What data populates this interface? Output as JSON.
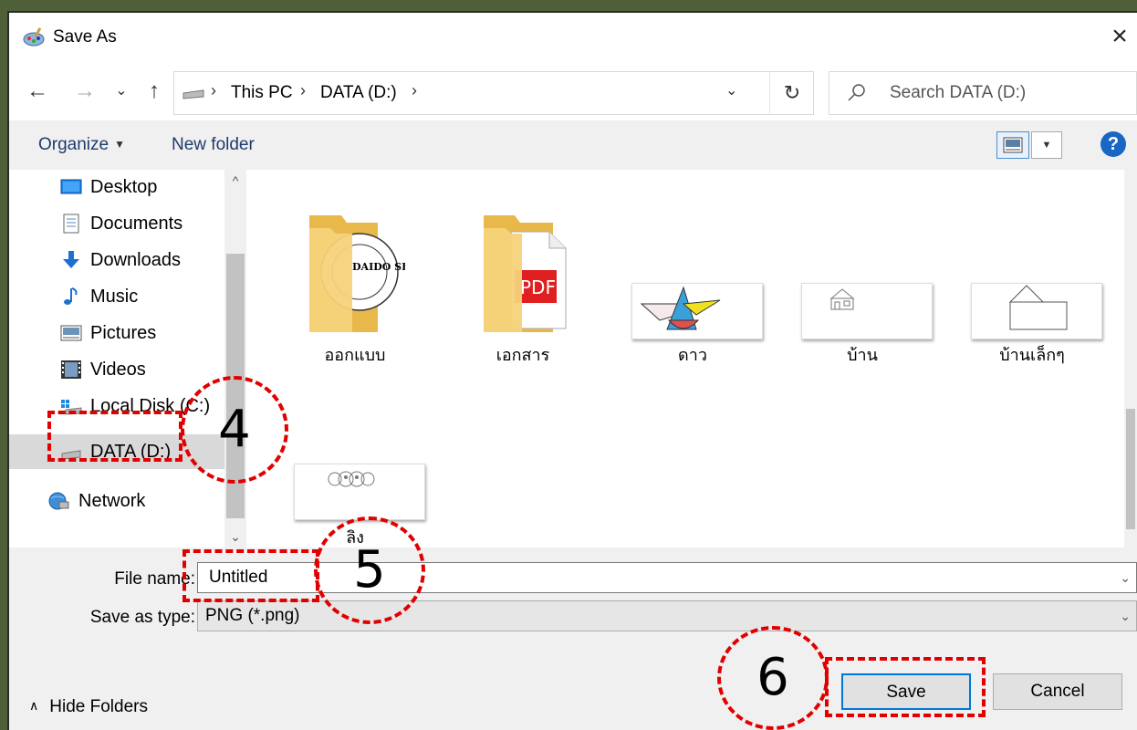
{
  "window": {
    "title": "Save As",
    "close": "×"
  },
  "nav": {
    "back": "←",
    "forward": "→",
    "recent": "⌄",
    "up": "↑",
    "breadcrumbs": [
      "This PC",
      "DATA (D:)"
    ],
    "separator": "›",
    "dropdown": "⌄",
    "refresh": "↻",
    "search_placeholder": "Search DATA (D:)"
  },
  "commandbar": {
    "organize": "Organize",
    "new_folder": "New folder",
    "help": "?"
  },
  "sidebar": {
    "items": [
      {
        "label": "Desktop",
        "icon": "desktop-icon"
      },
      {
        "label": "Documents",
        "icon": "documents-icon"
      },
      {
        "label": "Downloads",
        "icon": "downloads-icon"
      },
      {
        "label": "Music",
        "icon": "music-icon"
      },
      {
        "label": "Pictures",
        "icon": "pictures-icon"
      },
      {
        "label": "Videos",
        "icon": "videos-icon"
      },
      {
        "label": "Local Disk (C:)",
        "icon": "local-disk-icon"
      },
      {
        "label": "DATA (D:)",
        "icon": "drive-icon",
        "selected": true
      },
      {
        "label": "Network",
        "icon": "network-icon"
      }
    ]
  },
  "files": [
    {
      "name": "ออกแบบ",
      "kind": "folder"
    },
    {
      "name": "เอกสาร",
      "kind": "folder"
    },
    {
      "name": "ดาว",
      "kind": "image"
    },
    {
      "name": "บ้าน",
      "kind": "image"
    },
    {
      "name": "บ้านเล็กๆ",
      "kind": "image"
    },
    {
      "name": "ลิง",
      "kind": "image"
    }
  ],
  "thumbs": {
    "folder_text": "DAIDO SHIKO",
    "pdf": "PDF"
  },
  "form": {
    "file_name_label": "File name:",
    "file_name_value": "Untitled",
    "type_label": "Save as type:",
    "type_value": "PNG (*.png)",
    "chevron": "⌄"
  },
  "footer": {
    "hide_folders": "Hide Folders",
    "caret": "∧",
    "save": "Save",
    "cancel": "Cancel"
  },
  "annotations": {
    "step4": "4",
    "step5": "5",
    "step6": "6"
  },
  "colors": {
    "annotation": "#e00000",
    "accent": "#0078d7",
    "background": "#4f5f38"
  }
}
